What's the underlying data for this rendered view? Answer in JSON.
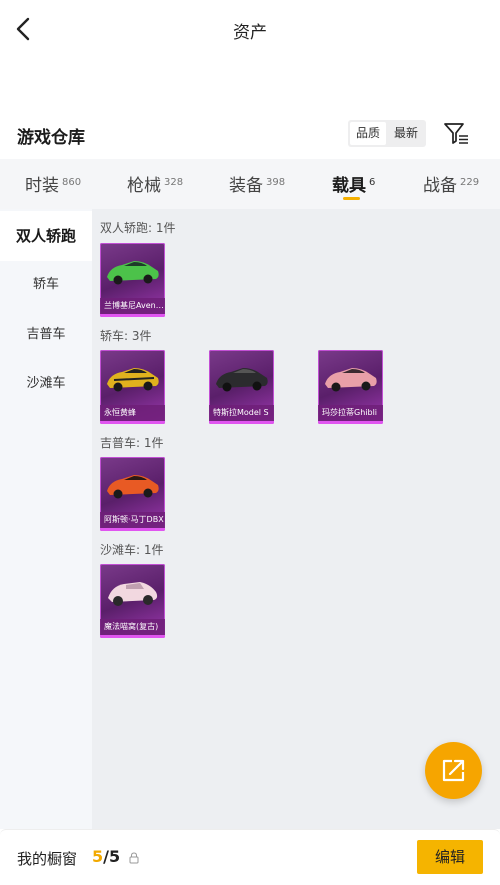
{
  "header": {
    "title": "资产"
  },
  "warehouse": {
    "title": "游戏仓库",
    "sort_quality": "品质",
    "sort_newest": "最新"
  },
  "tabs": [
    {
      "label": "时装",
      "count": "860"
    },
    {
      "label": "枪械",
      "count": "328"
    },
    {
      "label": "装备",
      "count": "398"
    },
    {
      "label": "载具",
      "count": "6"
    },
    {
      "label": "战备",
      "count": "229"
    }
  ],
  "sidebar": {
    "items": [
      "双人轿跑",
      "轿车",
      "吉普车",
      "沙滩车"
    ]
  },
  "groups": [
    {
      "title": "双人轿跑: 1件",
      "items": [
        {
          "name": "兰博基尼Aventador",
          "color": "#4cc24a"
        }
      ]
    },
    {
      "title": "轿车: 3件",
      "items": [
        {
          "name": "永恒黄蜂",
          "color": "#e0b21e"
        },
        {
          "name": "特斯拉Model S",
          "color": "#2b2b2e"
        },
        {
          "name": "玛莎拉蒂Ghibli",
          "color": "#e8a0a8"
        }
      ]
    },
    {
      "title": "吉普车: 1件",
      "items": [
        {
          "name": "阿斯顿·马丁DBX",
          "color": "#e85a24"
        }
      ]
    },
    {
      "title": "沙滩车: 1件",
      "items": [
        {
          "name": "魔法喵窝(复古)",
          "color": "#f2d8e0"
        }
      ]
    }
  ],
  "bottom": {
    "label": "我的橱窗",
    "count_current": "5",
    "count_total": "/5",
    "edit_label": "编辑"
  },
  "colors": {
    "accent": "#f5b400",
    "rarity": "#c24fd4"
  }
}
